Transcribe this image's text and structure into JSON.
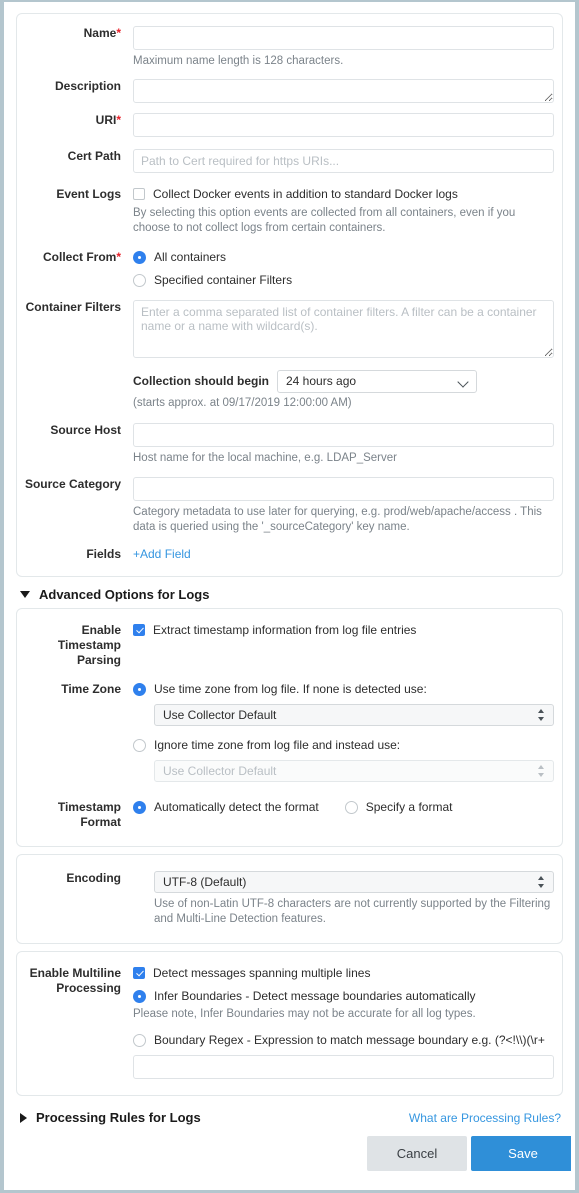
{
  "theme": {
    "accent": "#2f80ed",
    "link": "#3596e0",
    "save_button_bg": "#2f8fd8",
    "cancel_button_bg": "#dfe3e6",
    "required_marker": "#e8202a",
    "frame": "#b4c6ce"
  },
  "basic": {
    "name": {
      "label": "Name",
      "required": true,
      "value": "",
      "placeholder": "",
      "hint": "Maximum name length is 128 characters."
    },
    "description": {
      "label": "Description",
      "value": "",
      "placeholder": ""
    },
    "uri": {
      "label": "URI",
      "required": true,
      "value": "",
      "placeholder": ""
    },
    "cert_path": {
      "label": "Cert Path",
      "value": "",
      "placeholder": "Path to Cert required for https URIs..."
    },
    "event_logs": {
      "label": "Event Logs",
      "checkbox_label": "Collect Docker events in addition to standard Docker logs",
      "checked": false,
      "hint": "By selecting this option events are collected from all containers, even if you choose to not collect logs from certain containers."
    },
    "collect_from": {
      "label": "Collect From",
      "required": true,
      "options": [
        {
          "label": "All containers",
          "selected": true
        },
        {
          "label": "Specified container Filters",
          "selected": false
        }
      ]
    },
    "container_filters": {
      "label": "Container Filters",
      "value": "",
      "placeholder": "Enter a comma separated list of container filters. A filter can be a container name or a name with wildcard(s)."
    },
    "collection_begin": {
      "label": "Collection should begin",
      "value": "24 hours ago",
      "options": [
        "24 hours ago"
      ],
      "hint": "(starts approx. at 09/17/2019 12:00:00 AM)"
    },
    "source_host": {
      "label": "Source Host",
      "value": "",
      "placeholder": "",
      "hint": "Host name for the local machine, e.g. LDAP_Server"
    },
    "source_category": {
      "label": "Source Category",
      "value": "",
      "placeholder": "",
      "hint": "Category metadata to use later for querying, e.g. prod/web/apache/access . This data is queried using the '_sourceCategory' key name."
    },
    "fields": {
      "label": "Fields",
      "add_link": "+Add Field"
    }
  },
  "advanced": {
    "title": "Advanced Options for Logs",
    "expanded": true,
    "timestamp_parsing": {
      "label": "Enable Timestamp Parsing",
      "checkbox_label": "Extract timestamp information from log file entries",
      "checked": true
    },
    "time_zone": {
      "label": "Time Zone",
      "option_use": {
        "label": "Use time zone from log file. If none is detected use:",
        "selected": true,
        "select_value": "Use Collector Default",
        "select_options": [
          "Use Collector Default"
        ]
      },
      "option_ignore": {
        "label": "Ignore time zone from log file and instead use:",
        "selected": false,
        "select_value": "Use Collector Default",
        "select_disabled": true
      }
    },
    "timestamp_format": {
      "label": "Timestamp Format",
      "options": [
        {
          "label": "Automatically detect the format",
          "selected": true
        },
        {
          "label": "Specify a format",
          "selected": false
        }
      ]
    },
    "encoding": {
      "label": "Encoding",
      "value": "UTF-8 (Default)",
      "options": [
        "UTF-8 (Default)"
      ],
      "hint": "Use of non-Latin UTF-8 characters are not currently supported by the Filtering and Multi-Line Detection features."
    },
    "multiline": {
      "label": "Enable Multiline Processing",
      "detect_label": "Detect messages spanning multiple lines",
      "detect_checked": true,
      "infer": {
        "label": "Infer Boundaries - Detect message boundaries automatically",
        "selected": true,
        "hint": "Please note, Infer Boundaries may not be accurate for all log types."
      },
      "regex": {
        "label": "Boundary Regex - Expression to match message boundary e.g. (?<!\\\\)(\\r+",
        "selected": false,
        "value": "",
        "placeholder": ""
      }
    }
  },
  "processing_rules": {
    "title": "Processing Rules for Logs",
    "expanded": false,
    "help_link": "What are Processing Rules?"
  },
  "footer": {
    "cancel_label": "Cancel",
    "save_label": "Save"
  }
}
